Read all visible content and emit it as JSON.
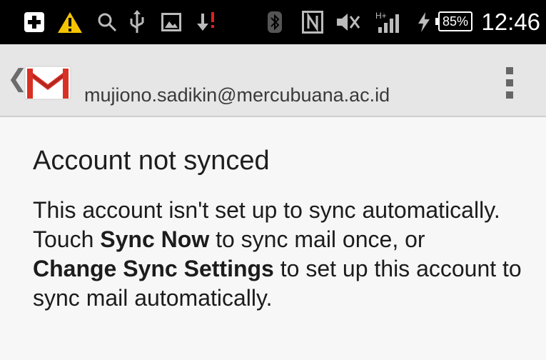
{
  "status_bar": {
    "icons": [
      "plus-icon",
      "warning-icon",
      "search-icon",
      "usb-icon",
      "image-icon",
      "download-icon",
      "bluetooth-icon",
      "nfc-icon",
      "mute-icon",
      "signal-icon",
      "charging-icon"
    ],
    "network_label": "H+",
    "battery_percent": "85%",
    "time": "12:46"
  },
  "action_bar": {
    "back_glyph": "❮",
    "app_icon": "gmail-icon",
    "account_email": "mujiono.sadikin@mercubuana.ac.id",
    "overflow_icon": "overflow-menu-icon"
  },
  "message": {
    "title": "Account not synced",
    "line1": "This account isn't set up to sync automatically.",
    "touch": "Touch",
    "sync_now": "Sync Now",
    "mid": "to sync mail once, or",
    "change_settings": "Change Sync Settings",
    "end": "to set up this account to sync mail automatically."
  },
  "colors": {
    "status_bar_bg": "#000000",
    "action_bar_bg": "#e6e6e6",
    "content_bg": "#f7f7f7",
    "gmail_red": "#d93025",
    "warning_yellow": "#f5c400"
  }
}
